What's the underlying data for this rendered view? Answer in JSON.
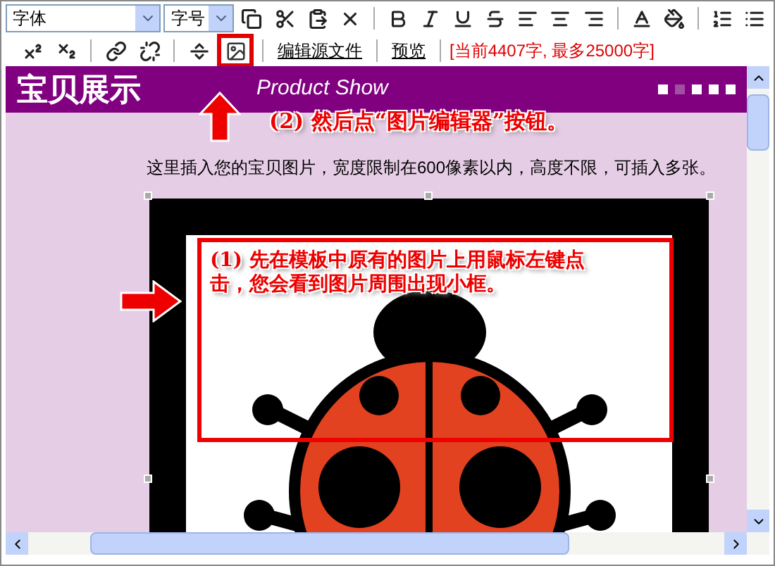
{
  "toolbar": {
    "font_select": {
      "value": "字体"
    },
    "size_select": {
      "value": "字号"
    },
    "links": [
      "编辑源文件",
      "预览"
    ],
    "counter": "[当前4407字, 最多25000字]"
  },
  "banner": {
    "title": "宝贝展示",
    "subtitle": "Product Show"
  },
  "intro": "这里插入您的宝贝图片，宽度限制在600像素以内，高度不限，可插入多张。",
  "annotations": [
    {
      "text": "(2) 然后点“图片编辑器”按钮。"
    },
    {
      "text": "(1) 先在模板中原有的图片上用鼠标左键点击，您会看到图片周围出现小框。"
    }
  ]
}
